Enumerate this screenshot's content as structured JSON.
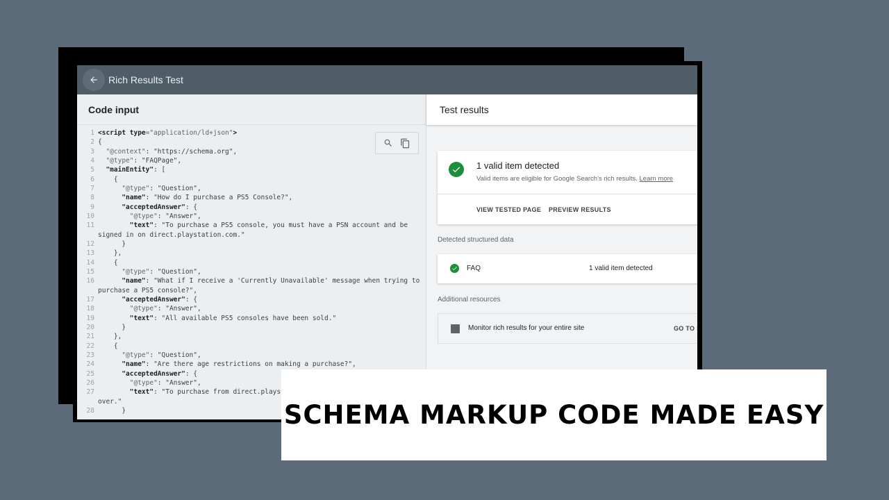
{
  "app": {
    "title": "Rich Results Test"
  },
  "code_input": {
    "header": "Code input",
    "lines": [
      {
        "n": "1",
        "parts": [
          {
            "t": "<script ",
            "c": "kw"
          },
          {
            "t": "type",
            "c": "kw"
          },
          {
            "t": "=\"application/ld+json\"",
            "c": "str"
          },
          {
            "t": ">",
            "c": "kw"
          }
        ]
      },
      {
        "n": "2",
        "parts": [
          {
            "t": "{",
            "c": ""
          }
        ]
      },
      {
        "n": "3",
        "parts": [
          {
            "t": "  \"@context\"",
            "c": "str"
          },
          {
            "t": ": \"https://schema.org\",",
            "c": ""
          }
        ]
      },
      {
        "n": "4",
        "parts": [
          {
            "t": "  \"@type\"",
            "c": "str"
          },
          {
            "t": ": \"FAQPage\",",
            "c": ""
          }
        ]
      },
      {
        "n": "5",
        "parts": [
          {
            "t": "  \"mainEntity\"",
            "c": "kw"
          },
          {
            "t": ": [",
            "c": ""
          }
        ]
      },
      {
        "n": "6",
        "parts": [
          {
            "t": "    {",
            "c": ""
          }
        ]
      },
      {
        "n": "7",
        "parts": [
          {
            "t": "      \"@type\"",
            "c": "str"
          },
          {
            "t": ": \"Question\",",
            "c": ""
          }
        ]
      },
      {
        "n": "8",
        "parts": [
          {
            "t": "      \"name\"",
            "c": "kw"
          },
          {
            "t": ": \"How do I purchase a PS5 Console?\",",
            "c": ""
          }
        ]
      },
      {
        "n": "9",
        "parts": [
          {
            "t": "      \"acceptedAnswer\"",
            "c": "kw"
          },
          {
            "t": ": {",
            "c": ""
          }
        ]
      },
      {
        "n": "10",
        "parts": [
          {
            "t": "        \"@type\"",
            "c": "str"
          },
          {
            "t": ": \"Answer\",",
            "c": ""
          }
        ]
      },
      {
        "n": "11",
        "parts": [
          {
            "t": "        \"text\"",
            "c": "kw"
          },
          {
            "t": ": \"To purchase a PS5 console, you must have a PSN account and be",
            "c": ""
          }
        ]
      },
      {
        "n": "",
        "parts": [
          {
            "t": "signed in on direct.playstation.com.\"",
            "c": ""
          }
        ]
      },
      {
        "n": "12",
        "parts": [
          {
            "t": "      }",
            "c": ""
          }
        ]
      },
      {
        "n": "13",
        "parts": [
          {
            "t": "    },",
            "c": ""
          }
        ]
      },
      {
        "n": "14",
        "parts": [
          {
            "t": "    {",
            "c": ""
          }
        ]
      },
      {
        "n": "15",
        "parts": [
          {
            "t": "      \"@type\"",
            "c": "str"
          },
          {
            "t": ": \"Question\",",
            "c": ""
          }
        ]
      },
      {
        "n": "16",
        "parts": [
          {
            "t": "      \"name\"",
            "c": "kw"
          },
          {
            "t": ": \"What if I receive a 'Currently Unavailable' message when trying to",
            "c": ""
          }
        ]
      },
      {
        "n": "",
        "parts": [
          {
            "t": "purchase a PS5 console?\",",
            "c": ""
          }
        ]
      },
      {
        "n": "17",
        "parts": [
          {
            "t": "      \"acceptedAnswer\"",
            "c": "kw"
          },
          {
            "t": ": {",
            "c": ""
          }
        ]
      },
      {
        "n": "18",
        "parts": [
          {
            "t": "        \"@type\"",
            "c": "str"
          },
          {
            "t": ": \"Answer\",",
            "c": ""
          }
        ]
      },
      {
        "n": "19",
        "parts": [
          {
            "t": "        \"text\"",
            "c": "kw"
          },
          {
            "t": ": \"All available PS5 consoles have been sold.\"",
            "c": ""
          }
        ]
      },
      {
        "n": "20",
        "parts": [
          {
            "t": "      }",
            "c": ""
          }
        ]
      },
      {
        "n": "21",
        "parts": [
          {
            "t": "    },",
            "c": ""
          }
        ]
      },
      {
        "n": "22",
        "parts": [
          {
            "t": "    {",
            "c": ""
          }
        ]
      },
      {
        "n": "23",
        "parts": [
          {
            "t": "      \"@type\"",
            "c": "str"
          },
          {
            "t": ": \"Question\",",
            "c": ""
          }
        ]
      },
      {
        "n": "24",
        "parts": [
          {
            "t": "      \"name\"",
            "c": "kw"
          },
          {
            "t": ": \"Are there age restrictions on making a purchase?\",",
            "c": ""
          }
        ]
      },
      {
        "n": "25",
        "parts": [
          {
            "t": "      \"acceptedAnswer\"",
            "c": "kw"
          },
          {
            "t": ": {",
            "c": ""
          }
        ]
      },
      {
        "n": "26",
        "parts": [
          {
            "t": "        \"@type\"",
            "c": "str"
          },
          {
            "t": ": \"Answer\",",
            "c": ""
          }
        ]
      },
      {
        "n": "27",
        "parts": [
          {
            "t": "        \"text\"",
            "c": "kw"
          },
          {
            "t": ": \"To purchase from direct.plays",
            "c": ""
          }
        ]
      },
      {
        "n": "",
        "parts": [
          {
            "t": "over.\"",
            "c": ""
          }
        ]
      },
      {
        "n": "28",
        "parts": [
          {
            "t": "      }",
            "c": ""
          }
        ]
      }
    ]
  },
  "results": {
    "header": "Test results",
    "valid_title": "1 valid item detected",
    "valid_sub": "Valid items are eligible for Google Search's rich results.",
    "learn_more": "Learn more",
    "view_tested": "VIEW TESTED PAGE",
    "preview": "PREVIEW RESULTS",
    "detected_label": "Detected structured data",
    "faq_label": "FAQ",
    "faq_status": "1 valid item detected",
    "additional_label": "Additional resources",
    "monitor_text": "Monitor rich results for your entire site",
    "goto": "GO TO S"
  },
  "banner": {
    "text": "SCHEMA MARKUP CODE MADE EASY"
  },
  "colors": {
    "background": "#5b6b79",
    "topbar": "#4f5d67",
    "success": "#1e8e3e"
  },
  "icons": [
    "arrow-back-icon",
    "search-icon",
    "copy-icon",
    "check-circle-icon",
    "bar-chart-icon"
  ]
}
